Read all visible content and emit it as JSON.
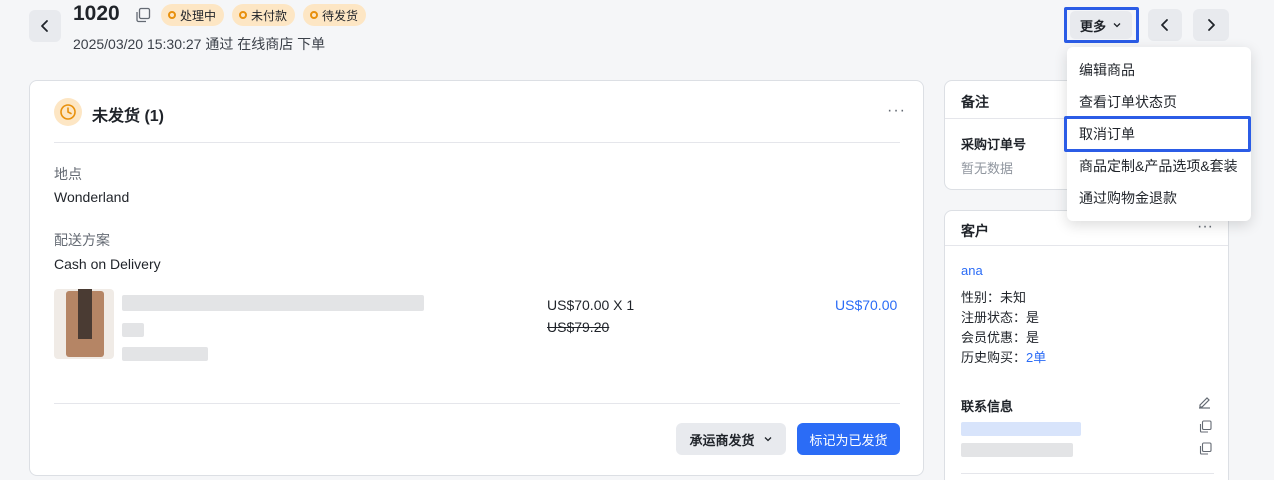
{
  "order": {
    "number": "1020",
    "badges": [
      "处理中",
      "未付款",
      "待发货"
    ],
    "subtitle": "2025/03/20 15:30:27 通过 在线商店 下单"
  },
  "header": {
    "more_label": "更多",
    "menu_items": [
      "编辑商品",
      "查看订单状态页",
      "取消订单",
      "商品定制&产品选项&套装",
      "通过购物金退款"
    ]
  },
  "fulfillment": {
    "title": "未发货 (1)",
    "location_label": "地点",
    "location_value": "Wonderland",
    "shipping_label": "配送方案",
    "shipping_value": "Cash on Delivery",
    "item_price": "US$70.00 X 1",
    "item_original_price": "US$79.20",
    "item_total": "US$70.00",
    "carrier_button": "承运商发货",
    "mark_shipped_button": "标记为已发货"
  },
  "notes": {
    "title": "备注",
    "po_label": "采购订单号",
    "po_value": "暂无数据"
  },
  "customer": {
    "title": "客户",
    "name": "ana",
    "gender_label": "性别：",
    "gender_value": "未知",
    "register_label": "注册状态：",
    "register_value": "是",
    "member_label": "会员优惠：",
    "member_value": "是",
    "history_label": "历史购买：",
    "history_value": "2单",
    "contact_title": "联系信息"
  },
  "colors": {
    "primary": "#2b6cf6",
    "badge_bg": "#fde6c4",
    "badge_dot": "#e8900c",
    "highlight": "#2b5ce6"
  }
}
